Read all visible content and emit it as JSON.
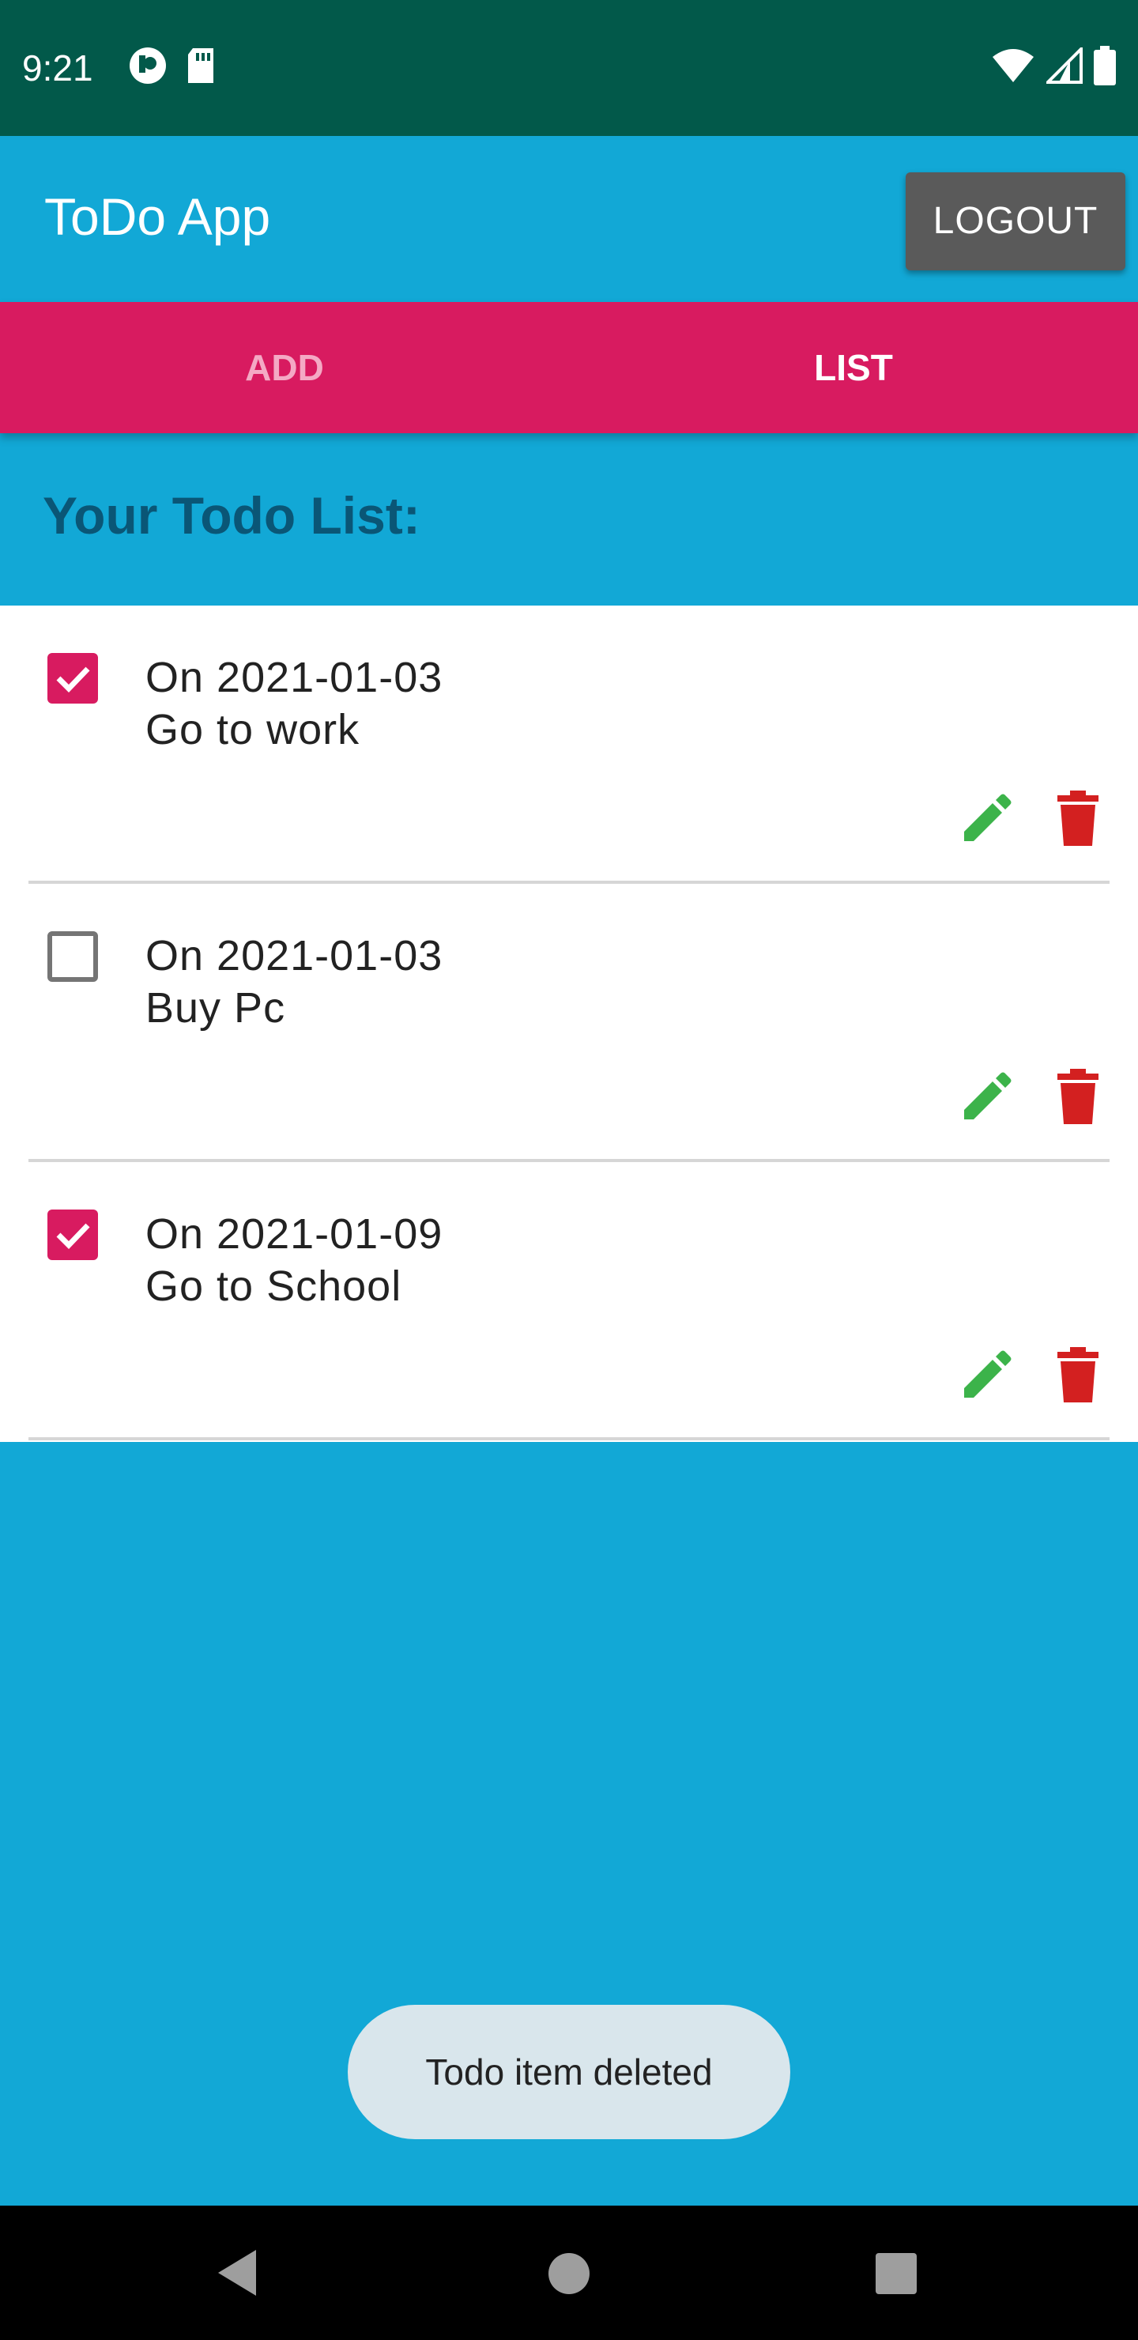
{
  "status_bar": {
    "time": "9:21",
    "left_icons": [
      "app-notification-icon",
      "sd-card-icon"
    ],
    "right_icons": [
      "wifi-icon",
      "cellular-signal-icon",
      "battery-icon"
    ]
  },
  "app_bar": {
    "title": "ToDo App",
    "logout_label": "LOGOUT"
  },
  "tabs": [
    {
      "label": "ADD",
      "selected": false
    },
    {
      "label": "LIST",
      "selected": true
    }
  ],
  "list_heading": "Your Todo List:",
  "todos": [
    {
      "date": "On 2021-01-03",
      "text": "Go to work",
      "checked": true
    },
    {
      "date": "On 2021-01-03",
      "text": "Buy Pc",
      "checked": false
    },
    {
      "date": "On 2021-01-09",
      "text": "Go to School",
      "checked": true
    }
  ],
  "toast": "Todo item deleted",
  "colors": {
    "status_bar": "#02594a",
    "primary": "#12a8d6",
    "accent": "#d81b60",
    "edit": "#3cb34a",
    "delete": "#d32020",
    "logout_button": "#5a5a5a"
  },
  "nav_bar": {
    "icons": [
      "back-icon",
      "home-icon",
      "recents-icon"
    ]
  }
}
